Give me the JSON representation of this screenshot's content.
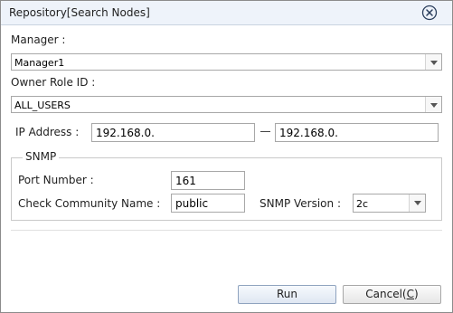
{
  "window": {
    "title": "Repository[Search Nodes]"
  },
  "manager": {
    "label": "Manager :",
    "value": "Manager1"
  },
  "owner_role": {
    "label": "Owner Role ID :",
    "value": "ALL_USERS"
  },
  "ip": {
    "label": "IP Address :",
    "from": "192.168.0.",
    "to": "192.168.0."
  },
  "snmp": {
    "legend": "SNMP",
    "port_label": "Port Number :",
    "port_value": "161",
    "community_label": "Check Community Name :",
    "community_value": "public",
    "version_label": "SNMP Version :",
    "version_value": "2c"
  },
  "buttons": {
    "run": "Run",
    "cancel_text": "Cancel(",
    "cancel_mnemonic": "C",
    "cancel_close": ")"
  },
  "icons": {
    "close": "close-circle-icon",
    "dropdown": "chevron-down-icon"
  }
}
